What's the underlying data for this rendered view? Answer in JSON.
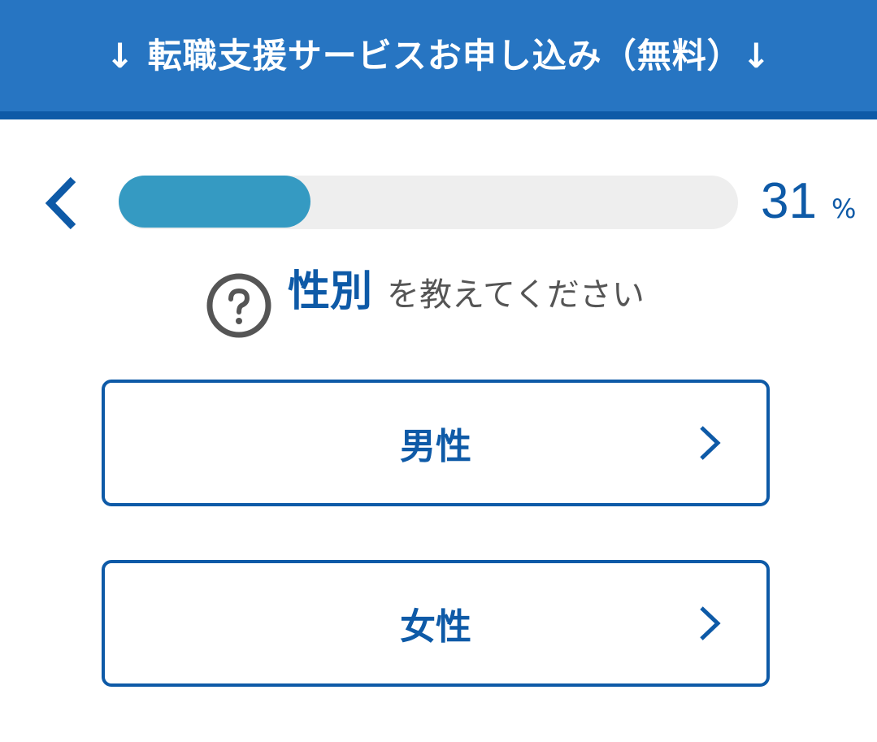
{
  "header": {
    "title": "↓ 転職支援サービスお申し込み（無料）↓"
  },
  "progress": {
    "percent": 31,
    "value_text": "31",
    "unit": "%"
  },
  "question": {
    "key": "性別",
    "rest": "を教えてください"
  },
  "options": [
    {
      "label": "男性"
    },
    {
      "label": "女性"
    }
  ],
  "icons": {
    "back": "chevron-left-icon",
    "help": "question-circle-icon",
    "option_arrow": "chevron-right-icon"
  },
  "colors": {
    "header_bg": "#2775c2",
    "accent": "#0e5aa7",
    "progress_fill": "#359ac2",
    "progress_track": "#eeeeee"
  }
}
